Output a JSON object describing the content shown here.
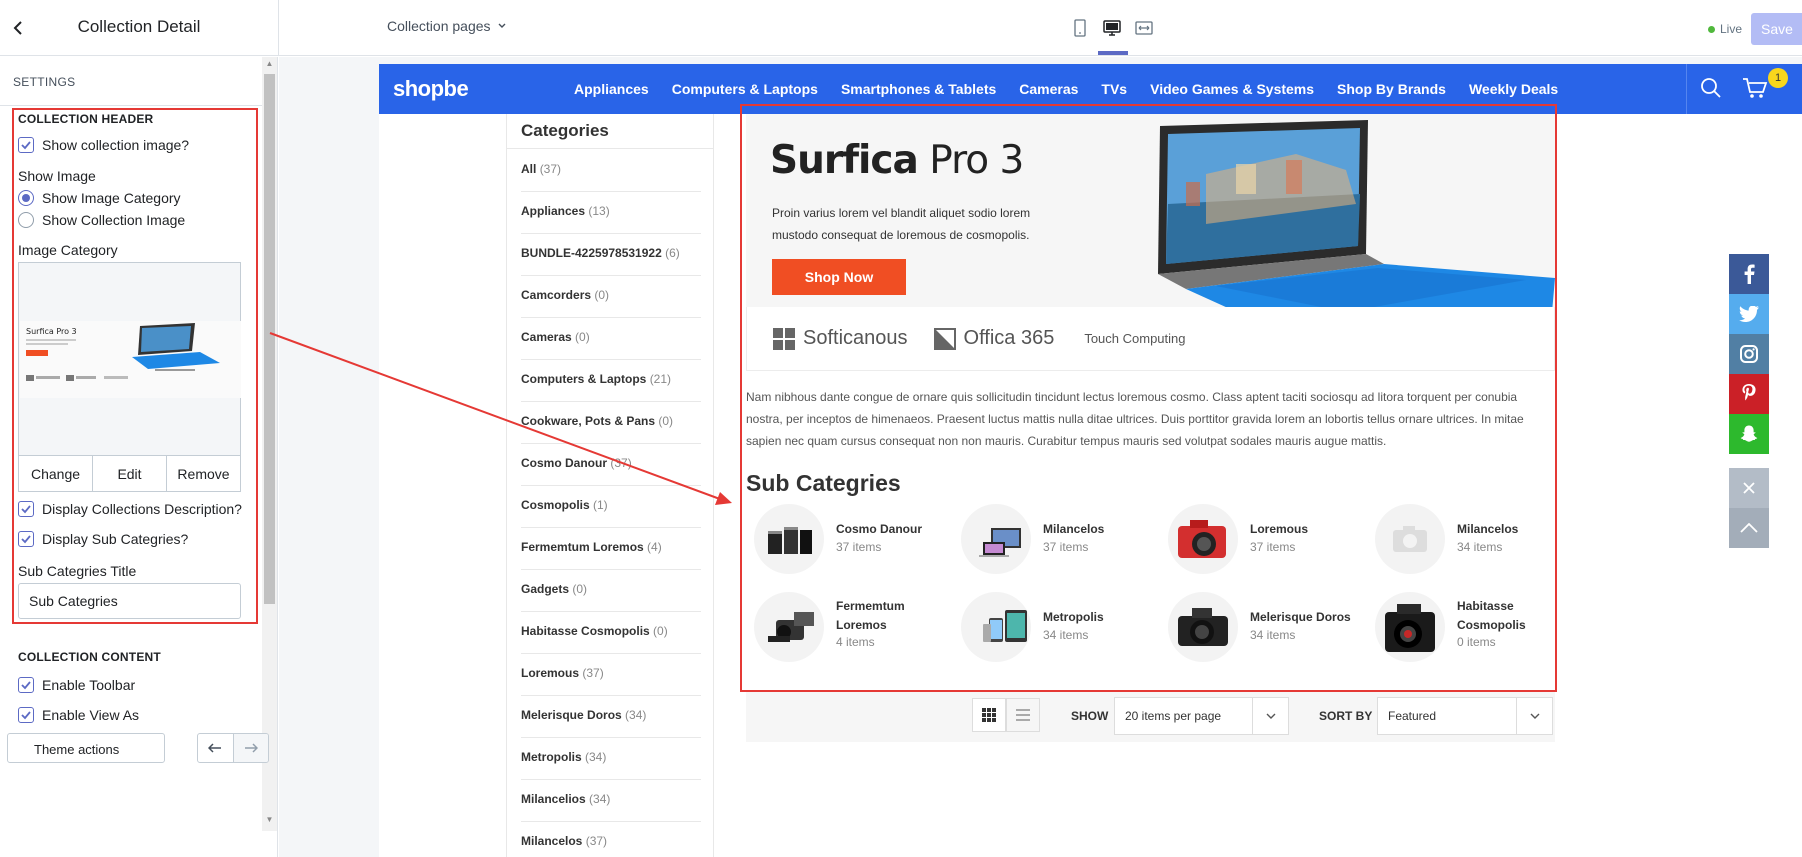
{
  "topbar": {
    "panel_title": "Collection Detail",
    "page_select": "Collection pages",
    "live_label": "Live",
    "save_label": "Save"
  },
  "settings": {
    "section_label": "SETTINGS",
    "collection_header": {
      "title": "COLLECTION HEADER",
      "show_image_checkbox": {
        "label": "Show collection image?",
        "checked": true
      },
      "show_image_label": "Show Image",
      "radio_options": [
        {
          "label": "Show Image Category",
          "selected": true
        },
        {
          "label": "Show Collection Image",
          "selected": false
        }
      ],
      "image_category_label": "Image Category",
      "image_actions": [
        "Change",
        "Edit",
        "Remove"
      ],
      "display_description": {
        "label": "Display Collections Description?",
        "checked": true
      },
      "display_sub_categories": {
        "label": "Display Sub Categries?",
        "checked": true
      },
      "sub_title_label": "Sub Categries Title",
      "sub_title_value": "Sub Categries"
    },
    "collection_content": {
      "title": "COLLECTION CONTENT",
      "enable_toolbar": {
        "label": "Enable Toolbar",
        "checked": true
      },
      "enable_view_as": {
        "label": "Enable View As",
        "checked": true
      }
    },
    "bottom_button": "Theme actions"
  },
  "store": {
    "logo": "shopbe",
    "nav": [
      "Appliances",
      "Computers & Laptops",
      "Smartphones & Tablets",
      "Cameras",
      "TVs",
      "Video Games & Systems",
      "Shop By Brands",
      "Weekly Deals"
    ],
    "cart_count": "1",
    "categories_title": "Categories",
    "categories": [
      {
        "name": "All",
        "count": "(37)"
      },
      {
        "name": "Appliances",
        "count": "(13)"
      },
      {
        "name": "BUNDLE-4225978531922",
        "count": "(6)"
      },
      {
        "name": "Camcorders",
        "count": "(0)"
      },
      {
        "name": "Cameras",
        "count": "(0)"
      },
      {
        "name": "Computers & Laptops",
        "count": "(21)"
      },
      {
        "name": "Cookware, Pots & Pans",
        "count": "(0)"
      },
      {
        "name": "Cosmo Danour",
        "count": "(37)"
      },
      {
        "name": "Cosmopolis",
        "count": "(1)"
      },
      {
        "name": "Fermemtum Loremos",
        "count": "(4)"
      },
      {
        "name": "Gadgets",
        "count": "(0)"
      },
      {
        "name": "Habitasse Cosmopolis",
        "count": "(0)"
      },
      {
        "name": "Loremous",
        "count": "(37)"
      },
      {
        "name": "Melerisque Doros",
        "count": "(34)"
      },
      {
        "name": "Metropolis",
        "count": "(34)"
      },
      {
        "name": "Milancelios",
        "count": "(34)"
      },
      {
        "name": "Milancelos",
        "count": "(37)"
      }
    ],
    "hero": {
      "title_bold": "Surfica",
      "title_rest": " Pro 3",
      "text": "Proin varius lorem vel blandit aliquet sodio lorem mustodo consequat de loremous de cosmopolis.",
      "button": "Shop Now",
      "brands": [
        "Softicanous",
        "Offica 365",
        "Touch Computing"
      ]
    },
    "description": "Nam nibhous dante congue de ornare quis sollicitudin tincidunt lectus loremous cosmo. Class aptent taciti sociosqu ad litora torquent per conubia nostra, per inceptos de himenaeos. Praesent luctus mattis nulla ditae ultrices. Duis porttitor gravida lorem an lobortis tellus ornare ultrices. In mitae sapien nec quam cursus consequat non non mauris. Curabitur tempus mauris sed volutpat sodales mauris augue mattis.",
    "sub_categories_title": "Sub Categries",
    "sub_categories": [
      {
        "name": "Cosmo Danour",
        "count": "37 items",
        "icon": "lens-icon"
      },
      {
        "name": "Milancelos",
        "count": "37 items",
        "icon": "laptop-icon"
      },
      {
        "name": "Loremous",
        "count": "37 items",
        "icon": "red-camera-icon"
      },
      {
        "name": "Milancelos",
        "count": "34 items",
        "icon": "camera-placeholder-icon"
      },
      {
        "name": "Fermemtum Loremos",
        "count": "4 items",
        "icon": "mirrorless-camera-icon"
      },
      {
        "name": "Metropolis",
        "count": "34 items",
        "icon": "tablets-icon"
      },
      {
        "name": "Melerisque Doros",
        "count": "34 items",
        "icon": "dslr-camera-icon"
      },
      {
        "name": "Habitasse Cosmopolis",
        "count": "0 items",
        "icon": "pro-camera-icon"
      }
    ],
    "toolbar": {
      "show_label": "SHOW",
      "show_value": "20 items per page",
      "sort_label": "SORT BY",
      "sort_value": "Featured"
    },
    "social": [
      "facebook-icon",
      "twitter-icon",
      "instagram-icon",
      "pinterest-icon",
      "snapchat-icon"
    ],
    "colors": {
      "nav": "#2964e8",
      "cta": "#f04e23",
      "highlight": "#e53935",
      "accent": "#5c6ac4"
    }
  }
}
